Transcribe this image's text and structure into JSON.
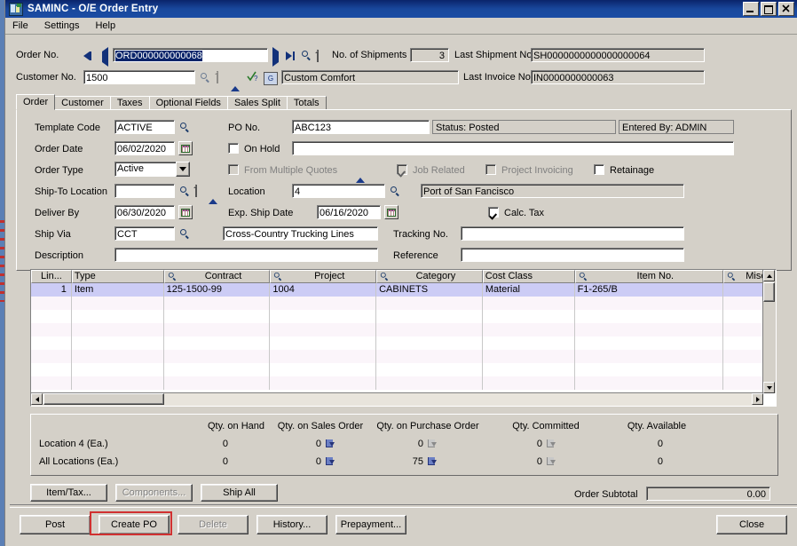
{
  "window": {
    "title": "SAMINC - O/E Order Entry",
    "app_icon": "application-icon",
    "minimize": "minimize-button",
    "maximize": "maximize-button",
    "close": "close-button"
  },
  "menu": [
    "File",
    "Settings",
    "Help"
  ],
  "header": {
    "order_no_label": "Order No.",
    "order_no_value": "ORD000000000068",
    "customer_no_label": "Customer No.",
    "customer_no_value": "1500",
    "customer_name": "Custom Comfort",
    "shipments_label": "No. of Shipments",
    "shipments_value": "3",
    "last_shipment_label": "Last Shipment No.",
    "last_shipment_value": "SH0000000000000000064",
    "last_invoice_label": "Last Invoice No.",
    "last_invoice_value": "IN0000000000063"
  },
  "tabs": [
    {
      "label": "Order",
      "active": true
    },
    {
      "label": "Customer",
      "active": false
    },
    {
      "label": "Taxes",
      "active": false
    },
    {
      "label": "Optional Fields",
      "active": false
    },
    {
      "label": "Sales Split",
      "active": false
    },
    {
      "label": "Totals",
      "active": false
    }
  ],
  "order_tab": {
    "template_code_label": "Template Code",
    "template_code_value": "ACTIVE",
    "order_date_label": "Order Date",
    "order_date_value": "06/02/2020",
    "order_type_label": "Order Type",
    "order_type_value": "Active",
    "ship_to_location_label": "Ship-To Location",
    "ship_to_location_value": "",
    "deliver_by_label": "Deliver By",
    "deliver_by_value": "06/30/2020",
    "ship_via_label": "Ship Via",
    "ship_via_value": "CCT",
    "ship_via_desc": "Cross-Country Trucking Lines",
    "description_label": "Description",
    "description_value": "",
    "po_no_label": "PO No.",
    "po_no_value": "ABC123",
    "status_text": "Status: Posted",
    "entered_by_text": "Entered By: ADMIN",
    "on_hold_label": "On Hold",
    "on_hold_checked": false,
    "on_hold_reason": "",
    "from_multiple_quotes_label": "From Multiple Quotes",
    "from_multiple_quotes_checked": false,
    "job_related_label": "Job Related",
    "job_related_checked": true,
    "project_invoicing_label": "Project Invoicing",
    "project_invoicing_checked": false,
    "retainage_label": "Retainage",
    "retainage_checked": false,
    "location_label": "Location",
    "location_value": "4",
    "location_desc": "Port of San Fancisco",
    "exp_ship_date_label": "Exp. Ship Date",
    "exp_ship_date_value": "06/16/2020",
    "calc_tax_label": "Calc. Tax",
    "calc_tax_checked": true,
    "tracking_no_label": "Tracking No.",
    "tracking_no_value": "",
    "reference_label": "Reference",
    "reference_value": ""
  },
  "grid": {
    "columns": [
      "Lin...",
      "Type",
      "Contract",
      "Project",
      "Category",
      "Cost Class",
      "Item No.",
      "Misc"
    ],
    "column_has_finder": [
      false,
      false,
      true,
      true,
      true,
      false,
      true,
      true
    ],
    "rows": [
      {
        "line": "1",
        "type": "Item",
        "contract": "125-1500-99",
        "project": "1004",
        "category": "CABINETS",
        "cost_class": "Material",
        "item_no": "F1-265/B",
        "misc": ""
      }
    ],
    "empty_row_count": 7
  },
  "qty_panel": {
    "headers": [
      "Qty. on Hand",
      "Qty. on Sales Order",
      "Qty. on Purchase Order",
      "Qty. Committed",
      "Qty. Available"
    ],
    "rows": [
      {
        "label": "Location  4 (Ea.)",
        "on_hand": "0",
        "on_sales_order": "0",
        "on_purchase_order": "0",
        "committed": "0",
        "available": "0"
      },
      {
        "label": "All Locations (Ea.)",
        "on_hand": "0",
        "on_sales_order": "0",
        "on_purchase_order": "75",
        "committed": "0",
        "available": "0"
      }
    ]
  },
  "action_buttons": [
    {
      "label": "Item/Tax...",
      "enabled": true
    },
    {
      "label": "Components...",
      "enabled": false
    },
    {
      "label": "Ship All",
      "enabled": true
    }
  ],
  "subtotal": {
    "label": "Order Subtotal",
    "value": "0.00"
  },
  "footer_buttons": [
    {
      "label": "Post",
      "enabled": true,
      "highlighted": false
    },
    {
      "label": "Create PO",
      "enabled": true,
      "highlighted": true
    },
    {
      "label": "Delete",
      "enabled": false,
      "highlighted": false
    },
    {
      "label": "History...",
      "enabled": true,
      "highlighted": false
    },
    {
      "label": "Prepayment...",
      "enabled": true,
      "highlighted": false
    }
  ],
  "close_button": "Close",
  "colors": {
    "highlight_box": "#d03030",
    "title_bar": "#19489c",
    "window_bg": "#d4d0c8",
    "selected_row": "#ccccf5"
  }
}
